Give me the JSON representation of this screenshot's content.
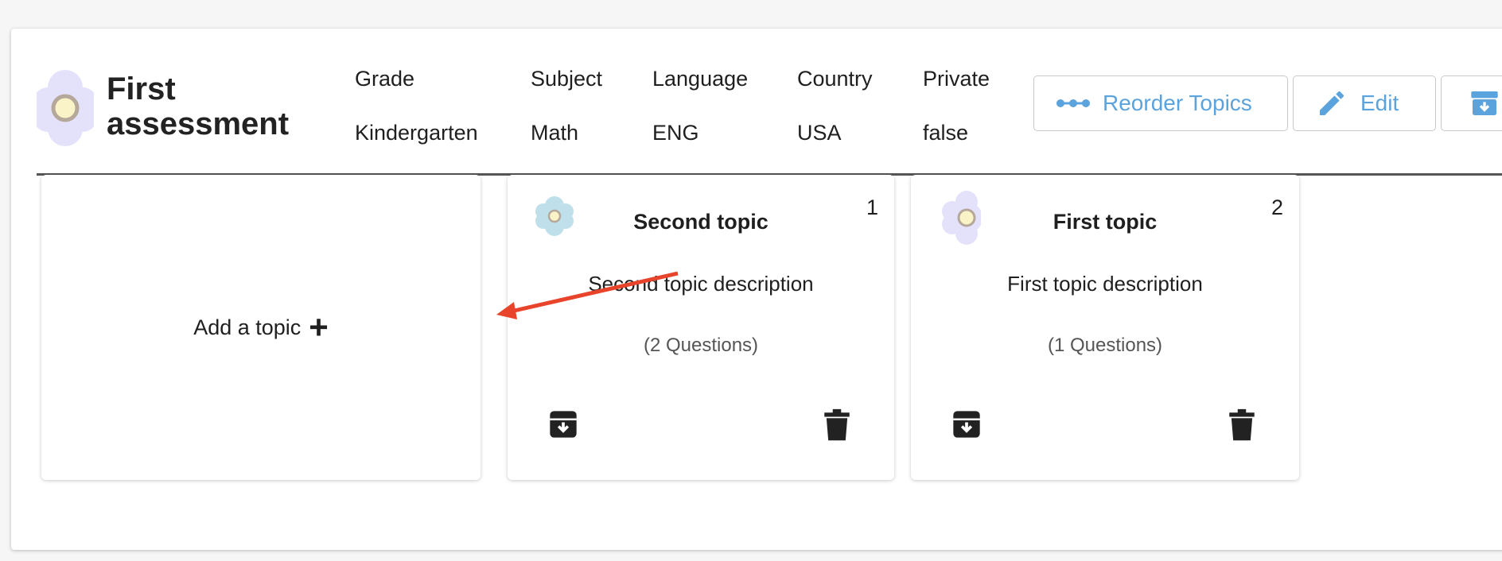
{
  "assessment": {
    "title": "First assessment",
    "meta": [
      {
        "label": "Grade",
        "value": "Kindergarten"
      },
      {
        "label": "Subject",
        "value": "Math"
      },
      {
        "label": "Language",
        "value": "ENG"
      },
      {
        "label": "Country",
        "value": "USA"
      },
      {
        "label": "Private",
        "value": "false"
      }
    ]
  },
  "toolbar": {
    "reorder_label": "Reorder Topics",
    "edit_label": "Edit",
    "accent_color": "#5ba3dd"
  },
  "add_topic": {
    "label": "Add a topic",
    "icon": "plus-icon"
  },
  "topics": [
    {
      "order": "1",
      "title": "Second topic",
      "description": "Second topic description",
      "questions": "(2 Questions)",
      "flower_color": "#bfe0ea"
    },
    {
      "order": "2",
      "title": "First topic",
      "description": "First topic description",
      "questions": "(1 Questions)",
      "flower_color": "#e4e2fb"
    }
  ],
  "annotation": {
    "color": "#e8432b",
    "icon": "red-arrow-icon"
  }
}
